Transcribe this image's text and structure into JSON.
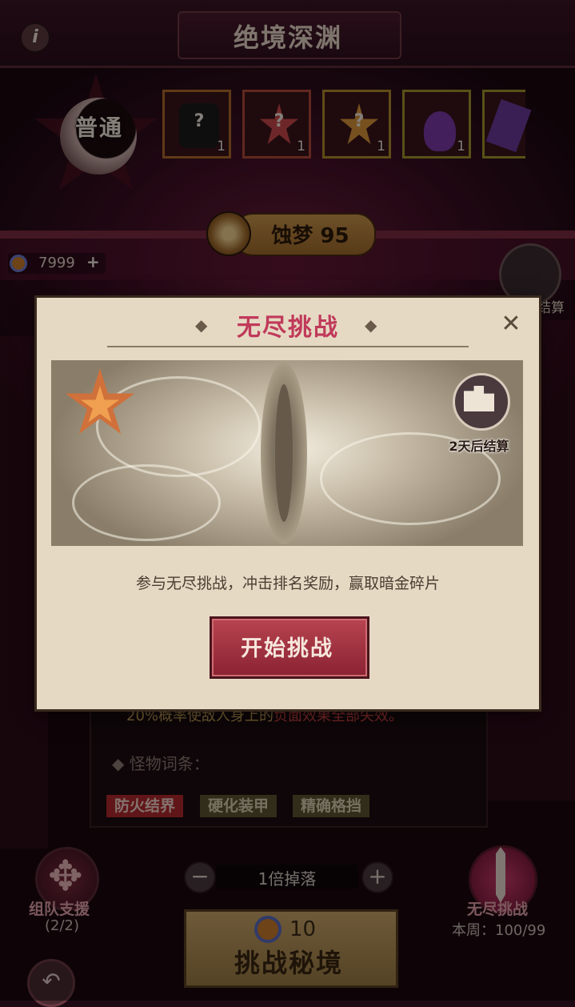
{
  "header": {
    "title": "绝境深渊",
    "info_icon": "info-icon"
  },
  "difficulty": {
    "label": "普通"
  },
  "items": [
    {
      "name": "mystery-gem-dark",
      "count": "1",
      "glyph": "?",
      "color": "#1a1a1a"
    },
    {
      "name": "mystery-star-red",
      "count": "1",
      "glyph": "?",
      "color": "#c8484a"
    },
    {
      "name": "mystery-star-gold",
      "count": "1",
      "glyph": "?",
      "color": "#d8943a"
    },
    {
      "name": "potion-purple",
      "count": "1",
      "glyph": "",
      "color": "#7a3aa8"
    },
    {
      "name": "crystal-purple",
      "count": "",
      "glyph": "",
      "color": "#6a3a9a"
    }
  ],
  "dream": {
    "label": "蚀梦 95"
  },
  "currency": {
    "value": "7999",
    "plus": "+"
  },
  "rank_side_label": "结算",
  "background_panel": {
    "effect_prefix": "20%概率使敌人身上的",
    "effect_neg": "负面效果全部失效。",
    "monster_title": "◆ 怪物词条：",
    "tags": [
      "防火结界",
      "硬化装甲",
      "精确格挡"
    ]
  },
  "bottom": {
    "team_label": "组队支援",
    "team_count": "(2/2)",
    "drop_label": "1倍掉落",
    "minus": "−",
    "plus": "+",
    "cost": "10",
    "challenge_label": "挑战秘境",
    "endless_label": "无尽挑战",
    "weekly_label": "本周：100/99",
    "back": "↶"
  },
  "dialog": {
    "title": "无尽挑战",
    "close": "✕",
    "deco_left": "◆",
    "deco_right": "◆",
    "settle_label": "2天后结算",
    "description": "参与无尽挑战，冲击排名奖励，赢取暗金碎片",
    "start_button": "开始挑战"
  }
}
